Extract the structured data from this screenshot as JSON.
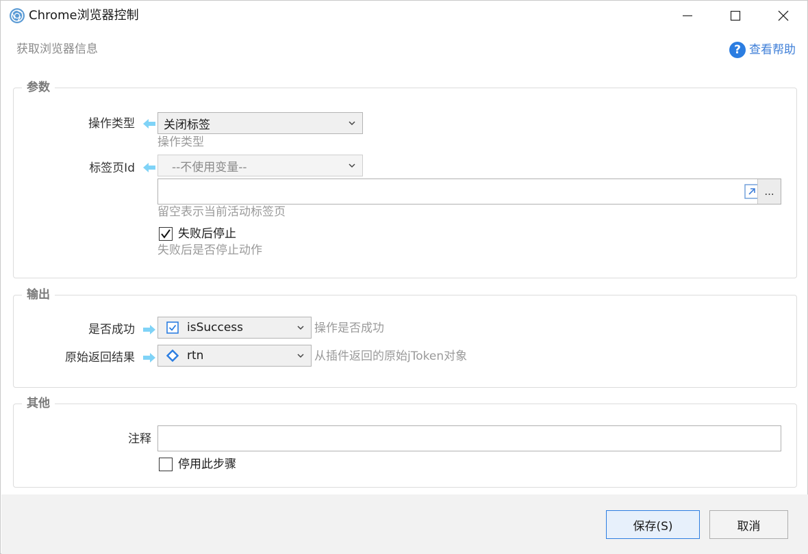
{
  "window": {
    "title": "Chrome浏览器控制",
    "subtitle": "获取浏览器信息",
    "help_label": "查看帮助"
  },
  "params": {
    "section_title": "参数",
    "op_type": {
      "label": "操作类型",
      "value": "关闭标签",
      "hint": "操作类型"
    },
    "tab_id": {
      "label": "标签页Id",
      "variable_placeholder": "--不使用变量--",
      "input_value": "",
      "more_label": "...",
      "hint": "留空表示当前活动标签页"
    },
    "stop_on_fail": {
      "checked": true,
      "label": "失败后停止",
      "hint": "失败后是否停止动作"
    }
  },
  "output": {
    "section_title": "输出",
    "is_success": {
      "label": "是否成功",
      "value": "isSuccess",
      "icon": "checkbox-variable-icon",
      "hint": "操作是否成功"
    },
    "raw_result": {
      "label": "原始返回结果",
      "value": "rtn",
      "icon": "diamond-variable-icon",
      "hint": "从插件返回的原始jToken对象"
    }
  },
  "other": {
    "section_title": "其他",
    "comment": {
      "label": "注释",
      "value": ""
    },
    "disable_step": {
      "checked": false,
      "label": "停用此步骤"
    }
  },
  "footer": {
    "save_label": "保存(S)",
    "cancel_label": "取消"
  },
  "colors": {
    "accent": "#2b7de1",
    "arrow": "#7fd3f7",
    "group_title": "#7a7a7a",
    "hint": "#9a9a9a"
  }
}
